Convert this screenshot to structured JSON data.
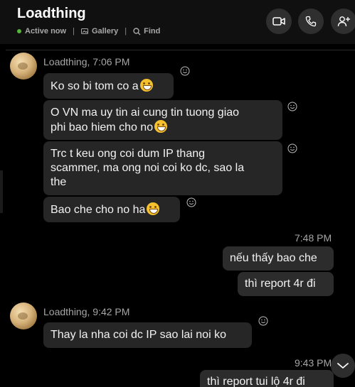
{
  "header": {
    "title": "Loadthing",
    "status": "Active now",
    "gallery": "Gallery",
    "find": "Find",
    "separator": "|"
  },
  "messages": {
    "g1_sender": "Loadthing, 7:06 PM",
    "m1": "Ko so bi tom co a",
    "m2": "O VN ma uy tin ai cung tin tuong giao\nphi bao hiem cho no",
    "m3": "Trc t keu ong coi dum IP thang\nscammer, ma ong noi coi ko dc, sao la\nthe",
    "m4": "Bao che cho no ha",
    "t1": "7:48 PM",
    "o1": "nếu thấy bao che",
    "o2": "thì report 4r đi",
    "g2_sender": "Loadthing, 9:42 PM",
    "m5": "Thay la nha coi dc IP sao lai noi ko",
    "t2": "9:43 PM",
    "o3": "thì report tui lộ 4r đi"
  }
}
